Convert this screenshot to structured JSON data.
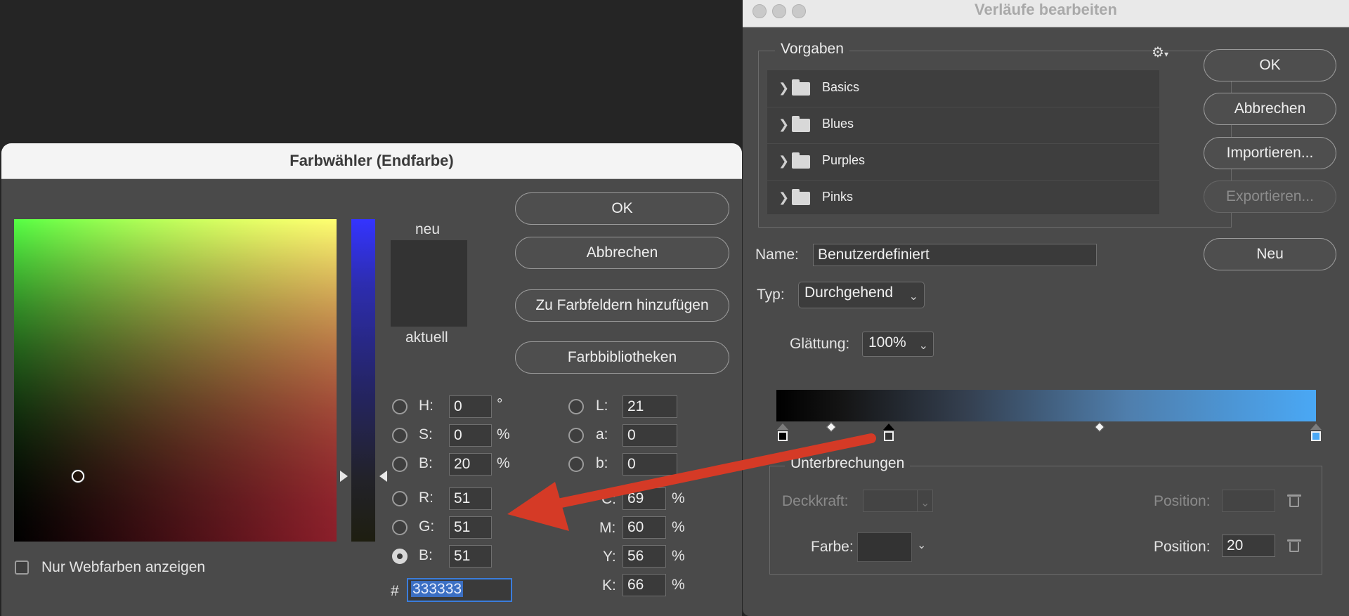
{
  "gradient_editor": {
    "title": "Verläufe bearbeiten",
    "presets": {
      "legend": "Vorgaben",
      "items": [
        "Basics",
        "Blues",
        "Purples",
        "Pinks"
      ],
      "icons": {
        "settings": "gear-icon",
        "folder": "folder-icon",
        "expand": "chevron-right-icon"
      }
    },
    "buttons": {
      "ok": "OK",
      "cancel": "Abbrechen",
      "import": "Importieren...",
      "export": "Exportieren...",
      "new": "Neu"
    },
    "name_label": "Name:",
    "name_value": "Benutzerdefiniert",
    "type_label": "Typ:",
    "type_value": "Durchgehend",
    "smoothness_label": "Glättung:",
    "smoothness_value": "100%",
    "stops": {
      "legend": "Unterbrechungen",
      "opacity_label": "Deckkraft:",
      "opacity_value": "",
      "position_label": "Position:",
      "opacity_position_value": "",
      "color_label": "Farbe:",
      "color_swatch": "#333333",
      "color_position_label": "Position:",
      "color_position_value": "20"
    },
    "gradient_colors": [
      "#000000",
      "#333333",
      "#4aa8f5"
    ]
  },
  "color_picker": {
    "title": "Farbwähler (Endfarbe)",
    "new_label": "neu",
    "current_label": "aktuell",
    "buttons": {
      "ok": "OK",
      "cancel": "Abbrechen",
      "add_to_swatches": "Zu Farbfeldern hinzufügen",
      "libraries": "Farbbibliotheken"
    },
    "hsb": {
      "h_label": "H:",
      "h": "0",
      "h_unit": "°",
      "s_label": "S:",
      "s": "0",
      "s_unit": "%",
      "b_label": "B:",
      "b": "20",
      "b_unit": "%"
    },
    "lab": {
      "l_label": "L:",
      "l": "21",
      "a_label": "a:",
      "a": "0",
      "b_label": "b:",
      "b": "0"
    },
    "rgb": {
      "r_label": "R:",
      "r": "51",
      "g_label": "G:",
      "g": "51",
      "b_label": "B:",
      "b": "51"
    },
    "cmyk": {
      "c_label": "C:",
      "c": "69",
      "m_label": "M:",
      "m": "60",
      "y_label": "Y:",
      "y": "56",
      "k_label": "K:",
      "k": "66",
      "unit": "%"
    },
    "hex_label": "#",
    "hex": "333333",
    "web_only_label": "Nur Webfarben anzeigen",
    "selected_channel": "B",
    "current_color": "#333333"
  },
  "annotation": {
    "arrow_color": "#d53a26"
  }
}
